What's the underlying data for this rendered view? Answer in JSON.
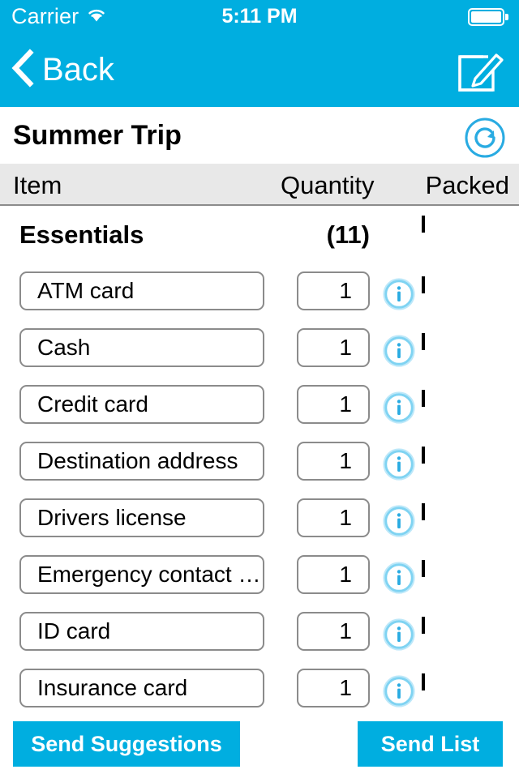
{
  "status_bar": {
    "carrier": "Carrier",
    "time": "5:11 PM",
    "wifi_icon": "wifi-icon",
    "battery_icon": "battery-full-icon"
  },
  "nav_bar": {
    "back_label": "Back",
    "back_icon": "chevron-left-icon",
    "compose_icon": "compose-icon",
    "background_color": "#00AEE0"
  },
  "title_bar": {
    "title": "Summer Trip",
    "refresh_icon": "refresh-icon",
    "refresh_color": "#29ABE2"
  },
  "column_headers": {
    "item": "Item",
    "quantity": "Quantity",
    "packed": "Packed"
  },
  "section": {
    "name": "Essentials",
    "count": "(11)",
    "checkbox_icon": "checkbox-unchecked-icon"
  },
  "items": [
    {
      "name": "ATM card",
      "quantity": "1",
      "info_icon": "info-icon",
      "checkbox_icon": "checkbox-unchecked-icon"
    },
    {
      "name": "Cash",
      "quantity": "1",
      "info_icon": "info-icon",
      "checkbox_icon": "checkbox-unchecked-icon"
    },
    {
      "name": "Credit card",
      "quantity": "1",
      "info_icon": "info-icon",
      "checkbox_icon": "checkbox-unchecked-icon"
    },
    {
      "name": "Destination address",
      "quantity": "1",
      "info_icon": "info-icon",
      "checkbox_icon": "checkbox-unchecked-icon"
    },
    {
      "name": "Drivers license",
      "quantity": "1",
      "info_icon": "info-icon",
      "checkbox_icon": "checkbox-unchecked-icon"
    },
    {
      "name": "Emergency contact det…",
      "quantity": "1",
      "info_icon": "info-icon",
      "checkbox_icon": "checkbox-unchecked-icon"
    },
    {
      "name": "ID card",
      "quantity": "1",
      "info_icon": "info-icon",
      "checkbox_icon": "checkbox-unchecked-icon"
    },
    {
      "name": "Insurance card",
      "quantity": "1",
      "info_icon": "info-icon",
      "checkbox_icon": "checkbox-unchecked-icon"
    }
  ],
  "footer": {
    "send_suggestions_label": "Send Suggestions",
    "send_list_label": "Send List",
    "button_color": "#00AEE0"
  }
}
